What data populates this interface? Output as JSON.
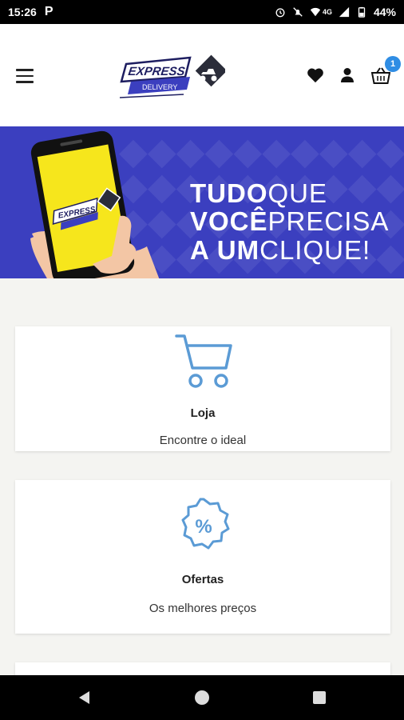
{
  "status_bar": {
    "time": "15:26",
    "app_indicator": "P",
    "network": "4G",
    "battery": "44%",
    "icons": [
      "alarm-icon",
      "mute-icon",
      "wifi-icon",
      "signal-icon",
      "battery-icon"
    ]
  },
  "header": {
    "logo_text_top": "EXPRESS",
    "logo_text_bottom": "DELIVERY",
    "cart_count": "1",
    "accent_color": "#2f8de4"
  },
  "banner": {
    "line1_bold": "TUDO",
    "line1_light": "QUE",
    "line2_bold": "VOCÊ",
    "line2_light": "PRECISA",
    "line3_bold": "A UM",
    "line3_light": "CLIQUE!",
    "background_color": "#3b3fbf"
  },
  "cards": [
    {
      "title": "Loja",
      "subtitle": "Encontre o ideal",
      "icon": "cart-icon"
    },
    {
      "title": "Ofertas",
      "subtitle": "Os melhores preços",
      "icon": "discount-icon"
    }
  ],
  "colors": {
    "icon_blue": "#5b9bd5",
    "page_bg": "#f4f4f1"
  }
}
